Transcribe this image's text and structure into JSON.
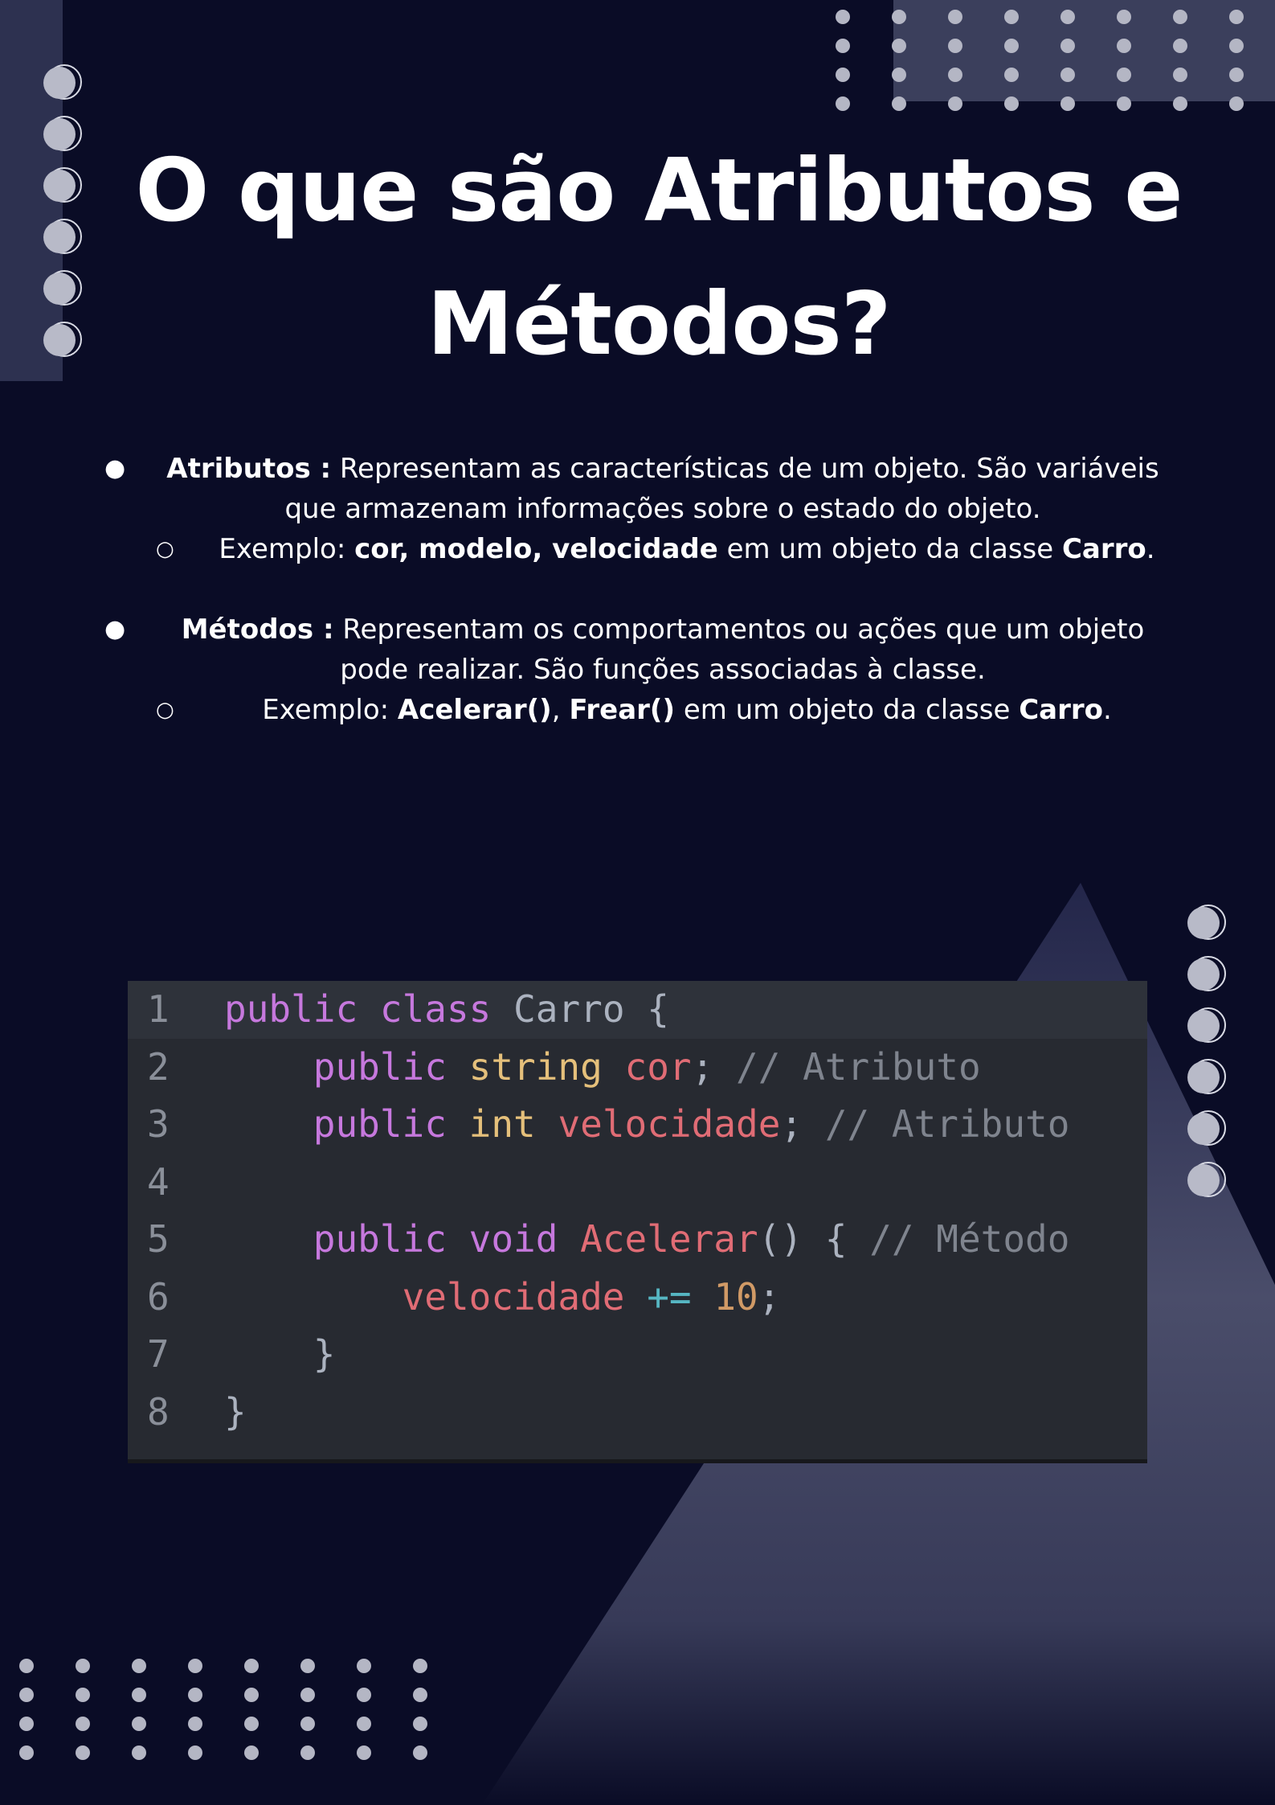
{
  "title": "O que são Atributos e Métodos?",
  "bullets": [
    {
      "term": "Atributos :",
      "description": " Representam as características de um objeto. São variáveis que armazenam informações sobre o estado do objeto.",
      "example_prefix": "Exemplo: ",
      "example_bold": "cor, modelo, velocidade",
      "example_mid": " em um objeto da classe ",
      "example_class": "Carro",
      "example_end": "."
    },
    {
      "term": "Métodos :",
      "description": " Representam os comportamentos ou ações que um objeto pode realizar. São funções associadas à classe.",
      "example_prefix": "Exemplo: ",
      "example_bold_1": "Acelerar()",
      "example_sep": ", ",
      "example_bold_2": "Frear()",
      "example_mid": " em um objeto da classe ",
      "example_class": "Carro",
      "example_end": "."
    }
  ],
  "code": {
    "line_numbers": [
      "1",
      "2",
      "3",
      "4",
      "5",
      "6",
      "7",
      "8"
    ],
    "l1": {
      "kw1": "public",
      "kw2": "class",
      "name": "Carro",
      "brace": " {"
    },
    "l2": {
      "kw": "public",
      "type": "string",
      "var": "cor",
      "punct": ";",
      "comment": "// Atributo"
    },
    "l3": {
      "kw": "public",
      "type": "int",
      "var": "velocidade",
      "punct": ";",
      "comment": "// Atributo"
    },
    "l5": {
      "kw": "public",
      "type": "void",
      "fn": "Acelerar",
      "paren": "() {",
      "comment": "// Método"
    },
    "l6": {
      "var": "velocidade",
      "op": "+=",
      "num": "10",
      "punct": ";"
    },
    "l7": {
      "brace": "}"
    },
    "l8": {
      "brace": "}"
    }
  },
  "colors": {
    "background": "#0a0c26",
    "keyword": "#c678dd",
    "type": "#e5c07b",
    "variable": "#e06c75",
    "comment": "#7f848e",
    "code_background": "#272a31"
  }
}
